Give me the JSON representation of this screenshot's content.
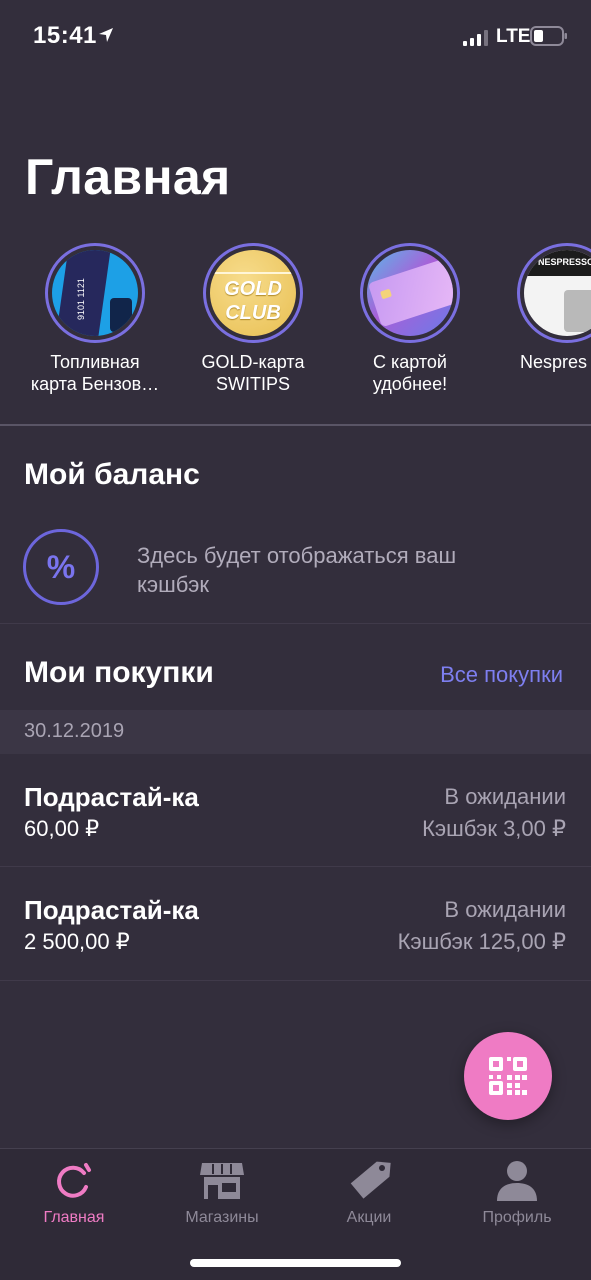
{
  "status_bar": {
    "time": "15:41",
    "network": "LTE"
  },
  "page_title": "Главная",
  "stories": [
    {
      "label": "Топливная\nкарта Бензов…",
      "image_text": "9101 1121"
    },
    {
      "label": "GOLD-карта\nSWITIPS",
      "image_text_1": "GOLD",
      "image_text_2": "CLUB"
    },
    {
      "label": "С картой\nудобнее!"
    },
    {
      "label": "Nespres",
      "image_text": "NESPRESSO"
    }
  ],
  "balance": {
    "title": "Мой баланс",
    "icon_symbol": "%",
    "text": "Здесь будет отображаться ваш кэшбэк"
  },
  "purchases": {
    "title": "Мои покупки",
    "all_link": "Все покупки",
    "date": "30.12.2019",
    "items": [
      {
        "name": "Подрастай-ка",
        "amount": "60,00 ₽",
        "status": "В ожидании",
        "cashback": "Кэшбэк 3,00 ₽"
      },
      {
        "name": "Подрастай-ка",
        "amount": "2 500,00 ₽",
        "status": "В ожидании",
        "cashback": "Кэшбэк 125,00 ₽"
      }
    ]
  },
  "tabbar": {
    "items": [
      {
        "label": "Главная",
        "icon": "home-swirl-icon",
        "active": true
      },
      {
        "label": "Магазины",
        "icon": "store-icon",
        "active": false
      },
      {
        "label": "Акции",
        "icon": "tag-icon",
        "active": false
      },
      {
        "label": "Профиль",
        "icon": "profile-icon",
        "active": false
      }
    ]
  },
  "colors": {
    "background": "#332e3c",
    "accent_pink": "#ef7bc4",
    "accent_purple": "#7e7ff0",
    "muted_text": "#a9a4b3"
  }
}
